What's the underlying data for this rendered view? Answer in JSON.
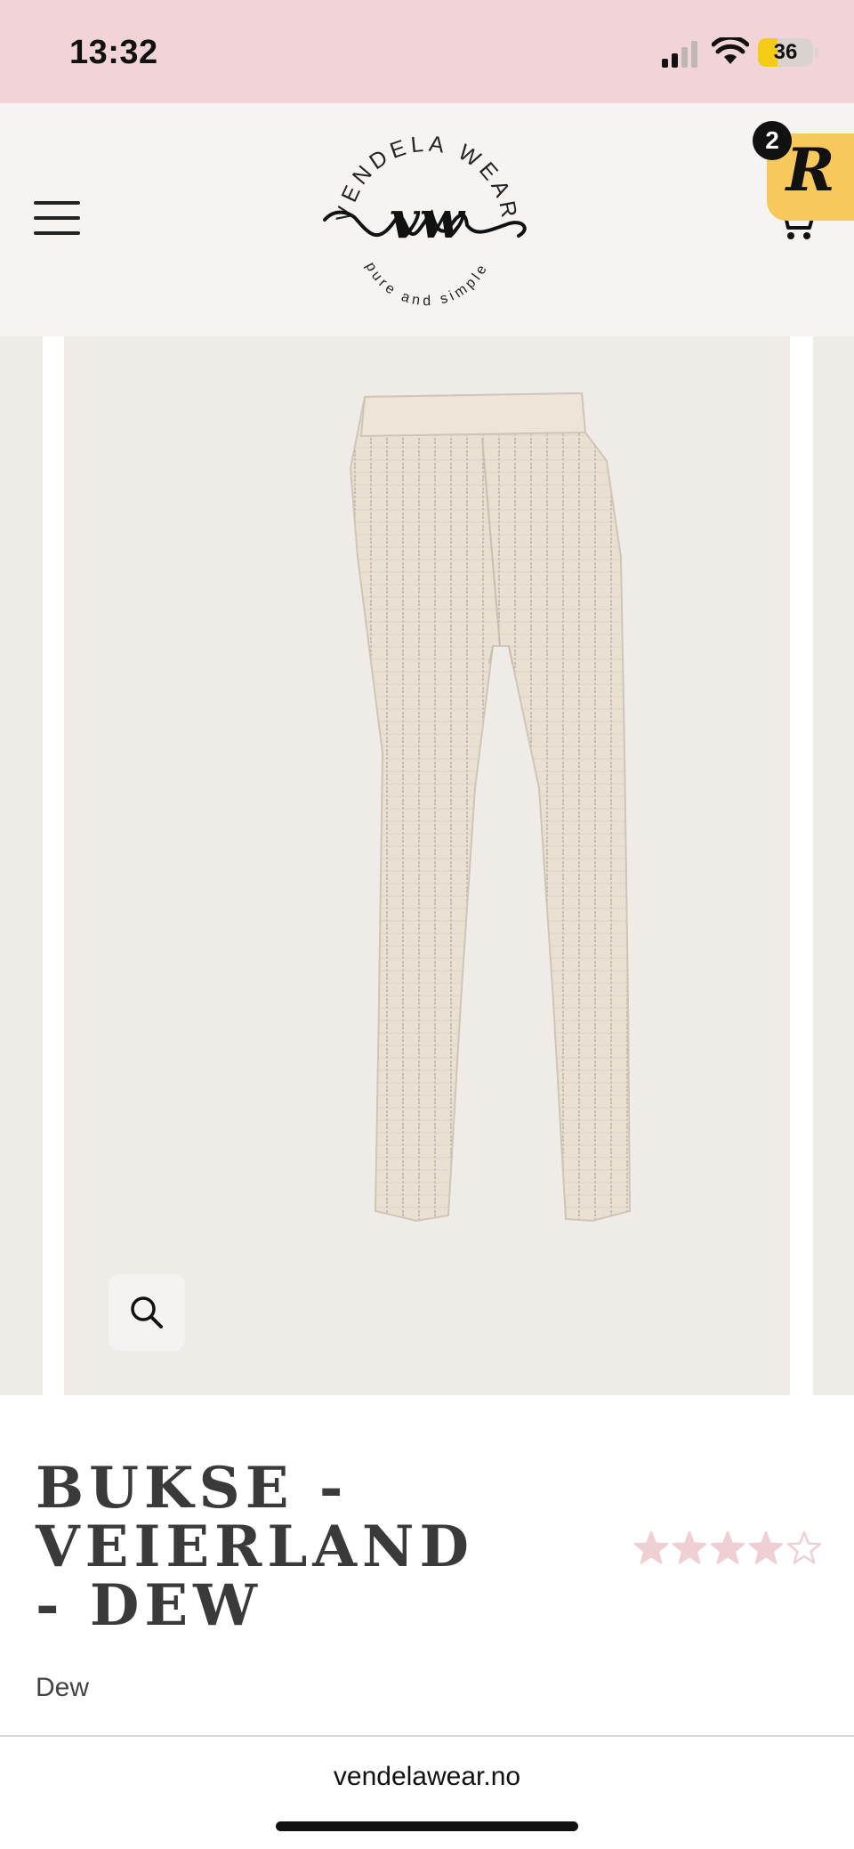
{
  "status_bar": {
    "time": "13:32",
    "battery_percent": "36",
    "battery_level": 0.36,
    "signal_bars_active": 2
  },
  "header": {
    "logo": {
      "brand_text": "VENDELA WEAR",
      "monogram": "vw",
      "tagline": "pure and simple"
    },
    "reward_badge": {
      "letter": "R",
      "count": "2"
    },
    "icons": [
      "menu-icon",
      "cart-icon"
    ]
  },
  "gallery": {
    "icons": [
      "zoom-icon"
    ]
  },
  "product": {
    "title": "BUKSE - VEIERLAND - DEW",
    "variant": "Dew",
    "rating": {
      "value": 4,
      "max": 5,
      "star_color": "#f0cfd4"
    }
  },
  "browser": {
    "url": "vendelawear.no"
  },
  "colors": {
    "status_bar_bg": "#f2d4d8",
    "header_bg": "#f6f4f3",
    "image_bg": "#efebe6",
    "battery_fill": "#f4cc16",
    "reward_badge_bg": "#f7c95d"
  }
}
